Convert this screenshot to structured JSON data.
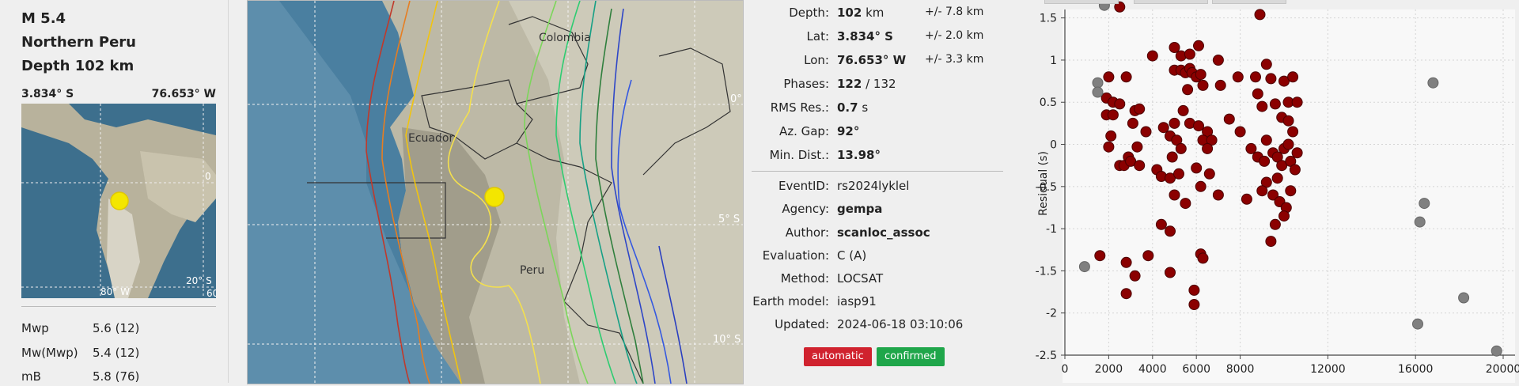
{
  "summary": {
    "magnitude": "M 5.4",
    "region": "Northern Peru",
    "depth": "Depth 102 km",
    "lat": "3.834° S",
    "lon": "76.653° W"
  },
  "minimap_labels": {
    "lon": "80° W",
    "lat0": "0",
    "lat20": "20° S",
    "cut": "60"
  },
  "magnitudes": [
    {
      "type": "Mwp",
      "value": "5.6 (12)"
    },
    {
      "type": "Mw(Mwp)",
      "value": "5.4 (12)"
    },
    {
      "type": "mB",
      "value": "5.8 (76)"
    }
  ],
  "map": {
    "countries": [
      "Colombia",
      "Ecuador",
      "Peru"
    ],
    "lat_labels": [
      "0°",
      "5° S",
      "10° S"
    ]
  },
  "origin": {
    "depth": {
      "label": "Depth:",
      "value": "102",
      "unit": "km",
      "unc": "+/- 7.8 km"
    },
    "lat": {
      "label": "Lat:",
      "value": "3.834° S",
      "unc": "+/- 2.0 km"
    },
    "lon": {
      "label": "Lon:",
      "value": "76.653° W",
      "unc": "+/- 3.3 km"
    },
    "phases": {
      "label": "Phases:",
      "used": "122",
      "total": "/ 132"
    },
    "rms": {
      "label": "RMS Res.:",
      "value": "0.7",
      "unit": "s"
    },
    "gap": {
      "label": "Az. Gap:",
      "value": "92°"
    },
    "mindist": {
      "label": "Min. Dist.:",
      "value": "13.98°"
    },
    "eventid": {
      "label": "EventID:",
      "value": "rs2024lyklel"
    },
    "agency": {
      "label": "Agency:",
      "value": "gempa"
    },
    "author": {
      "label": "Author:",
      "value": "scanloc_assoc"
    },
    "evaluation": {
      "label": "Evaluation:",
      "value": "C (A)"
    },
    "method": {
      "label": "Method:",
      "value": "LOCSAT"
    },
    "earthmodel": {
      "label": "Earth model:",
      "value": "iasp91"
    },
    "updated": {
      "label": "Updated:",
      "value": "2024-06-18 03:10:06"
    },
    "badges": {
      "automatic": "automatic",
      "confirmed": "confirmed"
    }
  },
  "colors": {
    "automatic": "#d0222e",
    "confirmed": "#1fa64a",
    "pick_used": "#8b0000",
    "pick_unused": "#808080",
    "epicenter": "#f3e600"
  },
  "chart_data": {
    "type": "scatter",
    "ylabel": "Residual (s)",
    "xlabel": "",
    "xlim": [
      0,
      20000
    ],
    "ylim": [
      -2.5,
      1.6
    ],
    "xticks": [
      0,
      2000,
      4000,
      6000,
      8000,
      12000,
      16000,
      20000
    ],
    "yticks": [
      1.5,
      1,
      0.5,
      0,
      -0.5,
      -1,
      -1.5,
      -2,
      -2.5
    ],
    "grid": true,
    "series": [
      {
        "color": "#8b0000",
        "points": [
          [
            2500,
            1.63
          ],
          [
            8900,
            1.54
          ],
          [
            2000,
            0.8
          ],
          [
            2800,
            0.8
          ],
          [
            1900,
            0.55
          ],
          [
            2200,
            0.5
          ],
          [
            2500,
            0.48
          ],
          [
            1900,
            0.35
          ],
          [
            2200,
            0.35
          ],
          [
            2100,
            0.1
          ],
          [
            2000,
            -0.03
          ],
          [
            2500,
            -0.25
          ],
          [
            2700,
            -0.25
          ],
          [
            2900,
            -0.15
          ],
          [
            3000,
            -0.2
          ],
          [
            3300,
            -0.03
          ],
          [
            3100,
            0.25
          ],
          [
            3200,
            0.4
          ],
          [
            3400,
            0.42
          ],
          [
            3700,
            0.15
          ],
          [
            3400,
            -0.25
          ],
          [
            4000,
            1.05
          ],
          [
            5000,
            1.15
          ],
          [
            5300,
            1.05
          ],
          [
            5700,
            1.07
          ],
          [
            6100,
            1.17
          ],
          [
            7000,
            1.0
          ],
          [
            5000,
            0.88
          ],
          [
            5300,
            0.88
          ],
          [
            5500,
            0.85
          ],
          [
            5700,
            0.9
          ],
          [
            5800,
            0.85
          ],
          [
            6000,
            0.8
          ],
          [
            6200,
            0.83
          ],
          [
            5600,
            0.65
          ],
          [
            6300,
            0.7
          ],
          [
            7100,
            0.7
          ],
          [
            7900,
            0.8
          ],
          [
            8700,
            0.8
          ],
          [
            9200,
            0.95
          ],
          [
            9400,
            0.78
          ],
          [
            10000,
            0.75
          ],
          [
            10400,
            0.8
          ],
          [
            8800,
            0.6
          ],
          [
            9600,
            0.48
          ],
          [
            10200,
            0.5
          ],
          [
            10600,
            0.5
          ],
          [
            4500,
            0.2
          ],
          [
            5000,
            0.25
          ],
          [
            5400,
            0.4
          ],
          [
            5700,
            0.25
          ],
          [
            6100,
            0.22
          ],
          [
            6500,
            0.15
          ],
          [
            7500,
            0.3
          ],
          [
            9000,
            0.45
          ],
          [
            9900,
            0.32
          ],
          [
            10200,
            0.28
          ],
          [
            10400,
            0.15
          ],
          [
            8000,
            0.15
          ],
          [
            4800,
            0.1
          ],
          [
            5100,
            0.05
          ],
          [
            5300,
            -0.05
          ],
          [
            4900,
            -0.15
          ],
          [
            6300,
            0.05
          ],
          [
            6700,
            0.05
          ],
          [
            6500,
            -0.05
          ],
          [
            8500,
            -0.05
          ],
          [
            9200,
            0.05
          ],
          [
            8800,
            -0.15
          ],
          [
            9500,
            -0.1
          ],
          [
            10000,
            -0.05
          ],
          [
            10200,
            0.0
          ],
          [
            10600,
            -0.1
          ],
          [
            9100,
            -0.2
          ],
          [
            9700,
            -0.15
          ],
          [
            9900,
            -0.25
          ],
          [
            10300,
            -0.2
          ],
          [
            10500,
            -0.3
          ],
          [
            4200,
            -0.3
          ],
          [
            4400,
            -0.38
          ],
          [
            4800,
            -0.4
          ],
          [
            5200,
            -0.35
          ],
          [
            6000,
            -0.28
          ],
          [
            6600,
            -0.35
          ],
          [
            6200,
            -0.5
          ],
          [
            5000,
            -0.6
          ],
          [
            5500,
            -0.7
          ],
          [
            7000,
            -0.6
          ],
          [
            8300,
            -0.65
          ],
          [
            9500,
            -0.6
          ],
          [
            9800,
            -0.68
          ],
          [
            10100,
            -0.75
          ],
          [
            10300,
            -0.55
          ],
          [
            9200,
            -0.45
          ],
          [
            9000,
            -0.55
          ],
          [
            9700,
            -0.4
          ],
          [
            10000,
            -0.85
          ],
          [
            9600,
            -0.95
          ],
          [
            9400,
            -1.15
          ],
          [
            4400,
            -0.95
          ],
          [
            4800,
            -1.03
          ],
          [
            1600,
            -1.32
          ],
          [
            2800,
            -1.4
          ],
          [
            3200,
            -1.56
          ],
          [
            3800,
            -1.32
          ],
          [
            4800,
            -1.52
          ],
          [
            6200,
            -1.3
          ],
          [
            6300,
            -1.35
          ],
          [
            2800,
            -1.77
          ],
          [
            5900,
            -1.73
          ],
          [
            5900,
            -1.9
          ]
        ]
      },
      {
        "color": "#808080",
        "points": [
          [
            1800,
            1.65
          ],
          [
            1500,
            0.73
          ],
          [
            1500,
            0.62
          ],
          [
            900,
            -1.45
          ],
          [
            16800,
            0.73
          ],
          [
            16400,
            -0.7
          ],
          [
            16200,
            -0.92
          ],
          [
            18200,
            -1.82
          ],
          [
            16100,
            -2.13
          ],
          [
            19700,
            -2.45
          ]
        ]
      }
    ]
  }
}
